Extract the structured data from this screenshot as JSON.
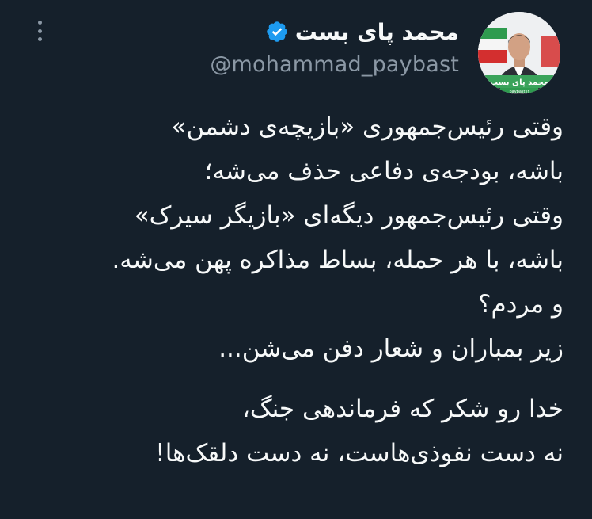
{
  "author": {
    "display_name": "محمد پای بست",
    "handle": "@mohammad_paybast",
    "verified": true,
    "avatar_label": "محمد پای بست",
    "avatar_caption": "paybast.ir"
  },
  "tweet": {
    "paragraph1": [
      "وقتی رئیس‌جمهوری «بازیچه‌ی دشمن»",
      "باشه، بودجه‌ی دفاعی حذف می‌شه؛",
      "وقتی رئیس‌جمهور دیگه‌ای «بازیگر سیرک»",
      "باشه، با هر حمله، بساط مذاکره پهن می‌شه.",
      "و مردم؟",
      "زیر بمباران و شعار دفن می‌شن..."
    ],
    "paragraph2": [
      "خدا رو شکر که فرماندهی جنگ،",
      "نه دست نفوذی‌هاست، نه دست دلقک‌ها!"
    ]
  },
  "colors": {
    "background": "#15202b",
    "text_primary": "#f7f9f9",
    "text_secondary": "#8b98a5",
    "verified_blue": "#1d9bf0"
  },
  "icons": {
    "more": "more-vertical-icon",
    "verified": "verified-badge-icon"
  }
}
